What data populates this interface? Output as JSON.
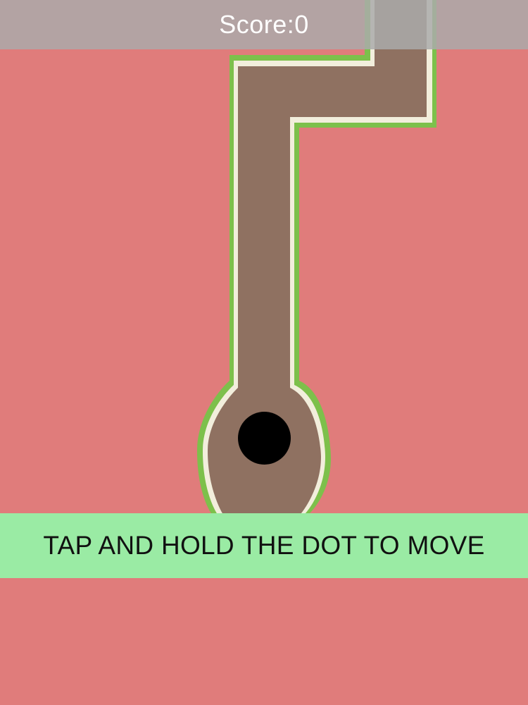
{
  "hud": {
    "score_text": "Score:0"
  },
  "instruction": {
    "text": "TAP AND HOLD THE DOT TO MOVE"
  },
  "colors": {
    "background": "#E07C7B",
    "track_fill": "#8F7161",
    "track_outline": "#7DC04B",
    "track_inner_edge": "#F2EEDC",
    "hud_bar": "#AAAAAA",
    "banner": "#9AEBA4",
    "dot": "#000000"
  }
}
